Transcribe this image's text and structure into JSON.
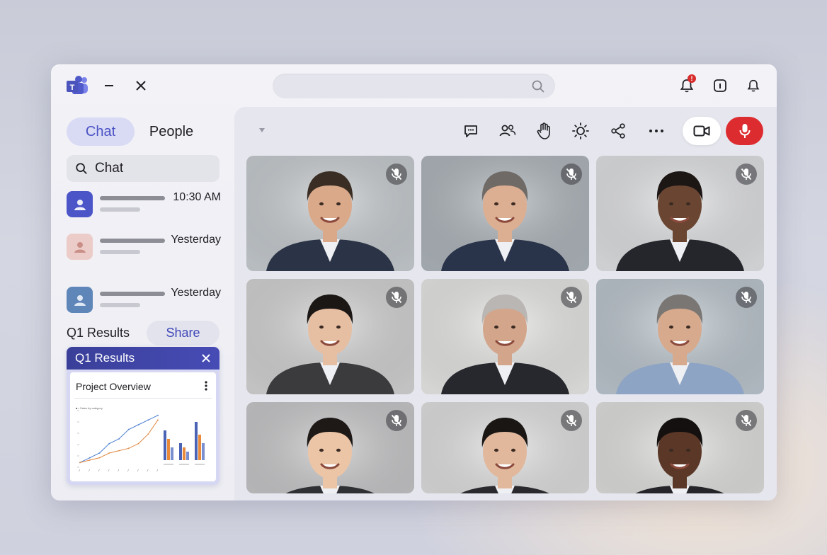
{
  "app": {
    "logo_icon": "teams-logo-icon",
    "minimize_icon": "minimize-icon",
    "close_icon": "close-icon"
  },
  "titlebar": {
    "search_placeholder": "",
    "notifications_badge": "!",
    "info_icon": "info-icon",
    "bell_icon": "bell-icon"
  },
  "sidebar": {
    "tabs": [
      {
        "label": "Chat",
        "active": true
      },
      {
        "label": "People",
        "active": false
      }
    ],
    "search_label": "Chat",
    "chats": [
      {
        "time": "10:30 AM",
        "avatar_color": "#4b55c8"
      },
      {
        "time": "Yesterday",
        "avatar_color": "#e8c4c0"
      },
      {
        "time": "Yesterday",
        "avatar_color": "#5f86b8"
      }
    ],
    "share_section_label": "Q1 Results",
    "share_button": "Share",
    "card": {
      "header": "Q1 Results",
      "title": "Project Overview",
      "legend_text": "■ • Sales by category"
    }
  },
  "stage": {
    "toolbar_icons": [
      "chat-icon",
      "people-icon",
      "raise-hand-icon",
      "effects-icon",
      "share-icon",
      "more-icon"
    ],
    "camera_icon": "video-camera-icon",
    "mic_icon": "microphone-icon",
    "mic_color": "#dd2c30",
    "participants": [
      {
        "muted": true,
        "bg": "#c7ccd0",
        "skin": "#d9a98a",
        "hair": "#3a2d24",
        "suit": "#2b3446"
      },
      {
        "muted": true,
        "bg": "#aeb5bb",
        "skin": "#dcae92",
        "hair": "#6f6a66",
        "suit": "#293349"
      },
      {
        "muted": true,
        "bg": "#e0e1e3",
        "skin": "#6a4632",
        "hair": "#1c1614",
        "suit": "#25262c"
      },
      {
        "muted": true,
        "bg": "#d3d3d3",
        "skin": "#e6bea2",
        "hair": "#1b1715",
        "suit": "#3b3b3e"
      },
      {
        "muted": true,
        "bg": "#e7e7e5",
        "skin": "#d3a68c",
        "hair": "#b9b6b3",
        "suit": "#26282e"
      },
      {
        "muted": true,
        "bg": "#bcc6ce",
        "skin": "#d7a98d",
        "hair": "#7a7673",
        "suit": "#8ea4c4"
      },
      {
        "muted": true,
        "bg": "#c7c7c9",
        "skin": "#ecc4a6",
        "hair": "#1e1916",
        "suit": "#2f3033"
      },
      {
        "muted": true,
        "bg": "#e0e0e0",
        "skin": "#e2b89d",
        "hair": "#1a1614",
        "suit": "#2a2a2e"
      },
      {
        "muted": true,
        "bg": "#e0e0de",
        "skin": "#5a3726",
        "hair": "#141010",
        "suit": "#26262a"
      }
    ]
  },
  "chart_data": {
    "type": "line",
    "title": "Project Overview",
    "x": [
      1,
      2,
      3,
      4,
      5,
      6,
      7,
      8,
      9
    ],
    "series": [
      {
        "values": [
          1,
          2,
          3,
          5,
          6,
          8,
          9,
          10,
          11
        ],
        "color": "#4b7fd1"
      },
      {
        "values": [
          1,
          1.5,
          2,
          3,
          3.5,
          4,
          5,
          7,
          10
        ],
        "color": "#e08a44"
      }
    ],
    "bars": [
      {
        "values": [
          7,
          4,
          9
        ],
        "color": "#4a63b5"
      },
      {
        "values": [
          5,
          3,
          6
        ],
        "color": "#e98a3b"
      },
      {
        "values": [
          3,
          2,
          4
        ],
        "color": "#7a8fcf"
      }
    ]
  }
}
